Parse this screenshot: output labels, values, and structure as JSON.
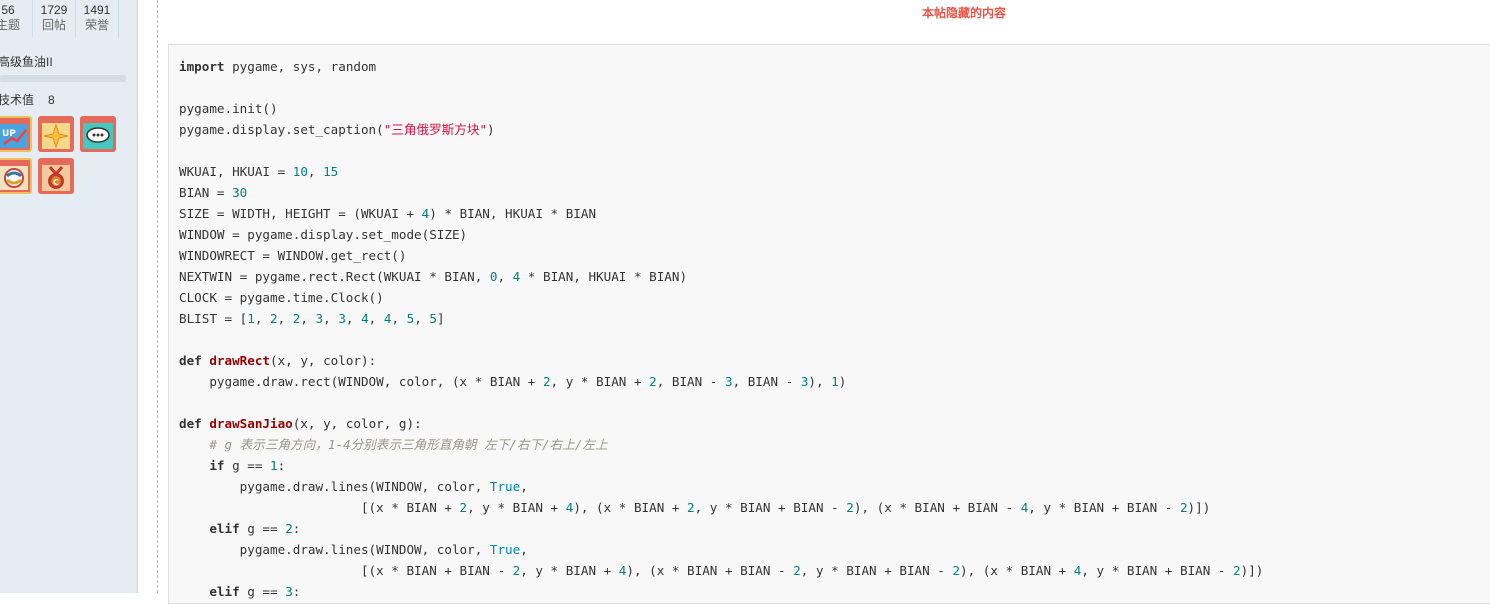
{
  "profile": {
    "stats": [
      {
        "value": "56",
        "label": "主题"
      },
      {
        "value": "1729",
        "label": "回帖"
      },
      {
        "value": "1491",
        "label": "荣誉"
      }
    ],
    "rank": "高级鱼油II",
    "tech_label": "技术值",
    "tech_value": "8",
    "medals": [
      "up-arrow-medal-icon",
      "sparkle-medal-icon",
      "chat-bubble-medal-icon",
      "python-medal-icon",
      "c-medal-icon"
    ]
  },
  "post": {
    "hidden_notice": "本帖隐藏的内容"
  },
  "code": {
    "lines": [
      [
        [
          "kw",
          "import"
        ],
        [
          "t",
          " pygame, sys, random"
        ]
      ],
      [],
      [
        [
          "t",
          "pygame.init()"
        ]
      ],
      [
        [
          "t",
          "pygame.display.set_caption("
        ],
        [
          "str",
          "\"三角俄罗斯方块\""
        ],
        [
          "t",
          ")"
        ]
      ],
      [],
      [
        [
          "t",
          "WKUAI, HKUAI = "
        ],
        [
          "num",
          "10"
        ],
        [
          "t",
          ", "
        ],
        [
          "num",
          "15"
        ]
      ],
      [
        [
          "t",
          "BIAN = "
        ],
        [
          "num",
          "30"
        ]
      ],
      [
        [
          "t",
          "SIZE = WIDTH, HEIGHT = (WKUAI + "
        ],
        [
          "num",
          "4"
        ],
        [
          "t",
          ") * BIAN, HKUAI * BIAN"
        ]
      ],
      [
        [
          "t",
          "WINDOW = pygame.display.set_mode(SIZE)"
        ]
      ],
      [
        [
          "t",
          "WINDOWRECT = WINDOW.get_rect()"
        ]
      ],
      [
        [
          "t",
          "NEXTWIN = pygame.rect.Rect(WKUAI * BIAN, "
        ],
        [
          "num",
          "0"
        ],
        [
          "t",
          ", "
        ],
        [
          "num",
          "4"
        ],
        [
          "t",
          " * BIAN, HKUAI * BIAN)"
        ]
      ],
      [
        [
          "t",
          "CLOCK = pygame.time.Clock()"
        ]
      ],
      [
        [
          "t",
          "BLIST = ["
        ],
        [
          "num",
          "1"
        ],
        [
          "t",
          ", "
        ],
        [
          "num",
          "2"
        ],
        [
          "t",
          ", "
        ],
        [
          "num",
          "2"
        ],
        [
          "t",
          ", "
        ],
        [
          "num",
          "3"
        ],
        [
          "t",
          ", "
        ],
        [
          "num",
          "3"
        ],
        [
          "t",
          ", "
        ],
        [
          "num",
          "4"
        ],
        [
          "t",
          ", "
        ],
        [
          "num",
          "4"
        ],
        [
          "t",
          ", "
        ],
        [
          "num",
          "5"
        ],
        [
          "t",
          ", "
        ],
        [
          "num",
          "5"
        ],
        [
          "t",
          "]"
        ]
      ],
      [],
      [
        [
          "kw",
          "def"
        ],
        [
          "t",
          " "
        ],
        [
          "fn",
          "drawRect"
        ],
        [
          "t",
          "(x, y, color):"
        ]
      ],
      [
        [
          "t",
          "    pygame.draw.rect(WINDOW, color, (x * BIAN + "
        ],
        [
          "num",
          "2"
        ],
        [
          "t",
          ", y * BIAN + "
        ],
        [
          "num",
          "2"
        ],
        [
          "t",
          ", BIAN - "
        ],
        [
          "num",
          "3"
        ],
        [
          "t",
          ", BIAN - "
        ],
        [
          "num",
          "3"
        ],
        [
          "t",
          "), "
        ],
        [
          "num",
          "1"
        ],
        [
          "t",
          ")"
        ]
      ],
      [],
      [
        [
          "kw",
          "def"
        ],
        [
          "t",
          " "
        ],
        [
          "fn",
          "drawSanJiao"
        ],
        [
          "t",
          "(x, y, color, g):"
        ]
      ],
      [
        [
          "t",
          "    "
        ],
        [
          "com",
          "# g 表示三角方向，1-4分别表示三角形直角朝 左下/右下/右上/左上"
        ]
      ],
      [
        [
          "t",
          "    "
        ],
        [
          "kw",
          "if"
        ],
        [
          "t",
          " g == "
        ],
        [
          "num",
          "1"
        ],
        [
          "t",
          ":"
        ]
      ],
      [
        [
          "t",
          "        pygame.draw.lines(WINDOW, color, "
        ],
        [
          "bi",
          "True"
        ],
        [
          "t",
          ","
        ]
      ],
      [
        [
          "t",
          "                        [(x * BIAN + "
        ],
        [
          "num",
          "2"
        ],
        [
          "t",
          ", y * BIAN + "
        ],
        [
          "num",
          "4"
        ],
        [
          "t",
          "), (x * BIAN + "
        ],
        [
          "num",
          "2"
        ],
        [
          "t",
          ", y * BIAN + BIAN - "
        ],
        [
          "num",
          "2"
        ],
        [
          "t",
          "), (x * BIAN + BIAN - "
        ],
        [
          "num",
          "4"
        ],
        [
          "t",
          ", y * BIAN + BIAN - "
        ],
        [
          "num",
          "2"
        ],
        [
          "t",
          ")])"
        ]
      ],
      [
        [
          "t",
          "    "
        ],
        [
          "kw",
          "elif"
        ],
        [
          "t",
          " g == "
        ],
        [
          "num",
          "2"
        ],
        [
          "t",
          ":"
        ]
      ],
      [
        [
          "t",
          "        pygame.draw.lines(WINDOW, color, "
        ],
        [
          "bi",
          "True"
        ],
        [
          "t",
          ","
        ]
      ],
      [
        [
          "t",
          "                        [(x * BIAN + BIAN - "
        ],
        [
          "num",
          "2"
        ],
        [
          "t",
          ", y * BIAN + "
        ],
        [
          "num",
          "4"
        ],
        [
          "t",
          "), (x * BIAN + BIAN - "
        ],
        [
          "num",
          "2"
        ],
        [
          "t",
          ", y * BIAN + BIAN - "
        ],
        [
          "num",
          "2"
        ],
        [
          "t",
          "), (x * BIAN + "
        ],
        [
          "num",
          "4"
        ],
        [
          "t",
          ", y * BIAN + BIAN - "
        ],
        [
          "num",
          "2"
        ],
        [
          "t",
          ")])"
        ]
      ],
      [
        [
          "t",
          "    "
        ],
        [
          "kw",
          "elif"
        ],
        [
          "t",
          " g == "
        ],
        [
          "num",
          "3"
        ],
        [
          "t",
          ":"
        ]
      ]
    ]
  }
}
